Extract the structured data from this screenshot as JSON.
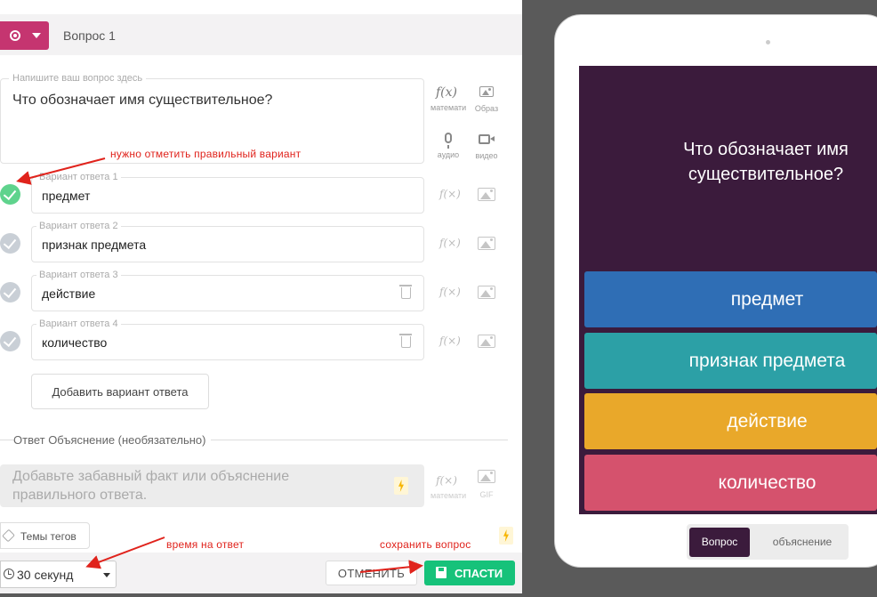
{
  "editor": {
    "question_title": "Вопрос 1",
    "question_placeholder": "Напишите ваш вопрос здесь",
    "question_text": "Что обозначает имя существительное?",
    "tools": {
      "math_label": "математи",
      "image_label": "Образ",
      "audio_label": "аудио",
      "video_label": "видео",
      "math_glyph": "f(x)",
      "eq_glyph": "f(×)"
    },
    "answers": [
      {
        "label": "Вариант ответа 1",
        "text": "предмет",
        "correct": true
      },
      {
        "label": "Вариант ответа 2",
        "text": "признак предмета",
        "correct": false
      },
      {
        "label": "Вариант ответа 3",
        "text": "действие",
        "correct": false
      },
      {
        "label": "Вариант ответа 4",
        "text": "количество",
        "correct": false
      }
    ],
    "add_answer_label": "Добавить вариант ответа",
    "explanation_title": "Ответ Объяснение (необязательно)",
    "explanation_placeholder": "Добавьте забавный факт или объяснение правильного ответа.",
    "explanation_tools": {
      "math_label": "математи",
      "media_label": "GIF"
    },
    "tags_label": "Темы тегов",
    "time_value": "30 секунд",
    "cancel_label": "ОТМЕНИТЬ",
    "save_label": "СПАСТИ"
  },
  "annotations": {
    "mark_correct": "нужно отметить правильный вариант",
    "answer_time": "время на ответ",
    "save_question": "сохранить вопрос"
  },
  "preview": {
    "question": "Что обозначает имя существительное?",
    "options": [
      "предмет",
      "признак предмета",
      "действие",
      "количество"
    ],
    "option_colors": [
      "#2f6eb5",
      "#2ca0a6",
      "#e9a82a",
      "#d5526d"
    ],
    "tab_question": "Вопрос",
    "tab_explanation": "объяснение"
  },
  "colors": {
    "accent_pink": "#c53570",
    "save_green": "#16c27a",
    "correct_green": "#5fd38d",
    "preview_bg": "#3b1b3c",
    "annotation_red": "#e0231c"
  }
}
